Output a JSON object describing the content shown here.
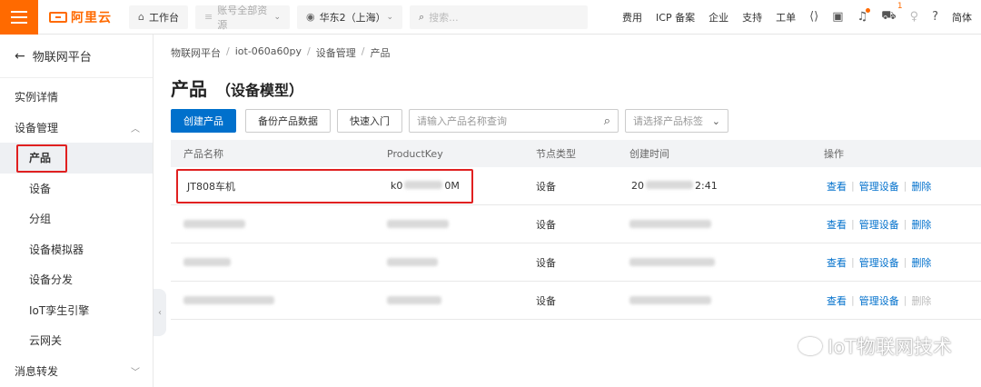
{
  "topbar": {
    "logo": "阿里云",
    "workbench": "工作台",
    "account_resources": "账号全部资源",
    "region": "华东2（上海）",
    "search_placeholder": "搜索...",
    "links": [
      "费用",
      "ICP 备案",
      "企业",
      "支持",
      "工单"
    ],
    "cart_count": "1",
    "language": "简体",
    "brand_color": "#ff6a00"
  },
  "sidebar": {
    "back_label": "物联网平台",
    "items": [
      {
        "label": "实例详情"
      },
      {
        "label": "设备管理"
      },
      {
        "label": "产品"
      },
      {
        "label": "设备"
      },
      {
        "label": "分组"
      },
      {
        "label": "设备模拟器"
      },
      {
        "label": "设备分发"
      },
      {
        "label": "IoT孪生引擎"
      },
      {
        "label": "云网关"
      },
      {
        "label": "消息转发"
      }
    ]
  },
  "breadcrumb": [
    "物联网平台",
    "iot-060a60py",
    "设备管理",
    "产品"
  ],
  "page": {
    "title": "产品",
    "subtitle": "（设备模型）"
  },
  "toolbar": {
    "create_label": "创建产品",
    "backup_label": "备份产品数据",
    "quickstart_label": "快速入门",
    "search_placeholder": "请输入产品名称查询",
    "tag_placeholder": "请选择产品标签"
  },
  "table": {
    "headers": [
      "产品名称",
      "ProductKey",
      "节点类型",
      "创建时间",
      "操作"
    ],
    "rows": [
      {
        "name": "JT808车机",
        "key_start": "k0",
        "key_end": "0M",
        "node_type": "设备",
        "time_start": "20",
        "time_end": "2:41",
        "ops": [
          "查看",
          "管理设备",
          "删除"
        ]
      },
      {
        "name": "",
        "key": "",
        "node_type": "设备",
        "time": "",
        "ops": [
          "查看",
          "管理设备",
          "删除"
        ]
      },
      {
        "name": "",
        "key": "",
        "node_type": "设备",
        "time": "",
        "ops": [
          "查看",
          "管理设备",
          "删除"
        ]
      },
      {
        "name": "",
        "key": "",
        "node_type": "设备",
        "time": "",
        "ops": [
          "查看",
          "管理设备",
          "删除"
        ]
      }
    ]
  },
  "watermark": "IoT物联网技术",
  "accent_color": "#0070cc",
  "highlight_color": "#e02020"
}
